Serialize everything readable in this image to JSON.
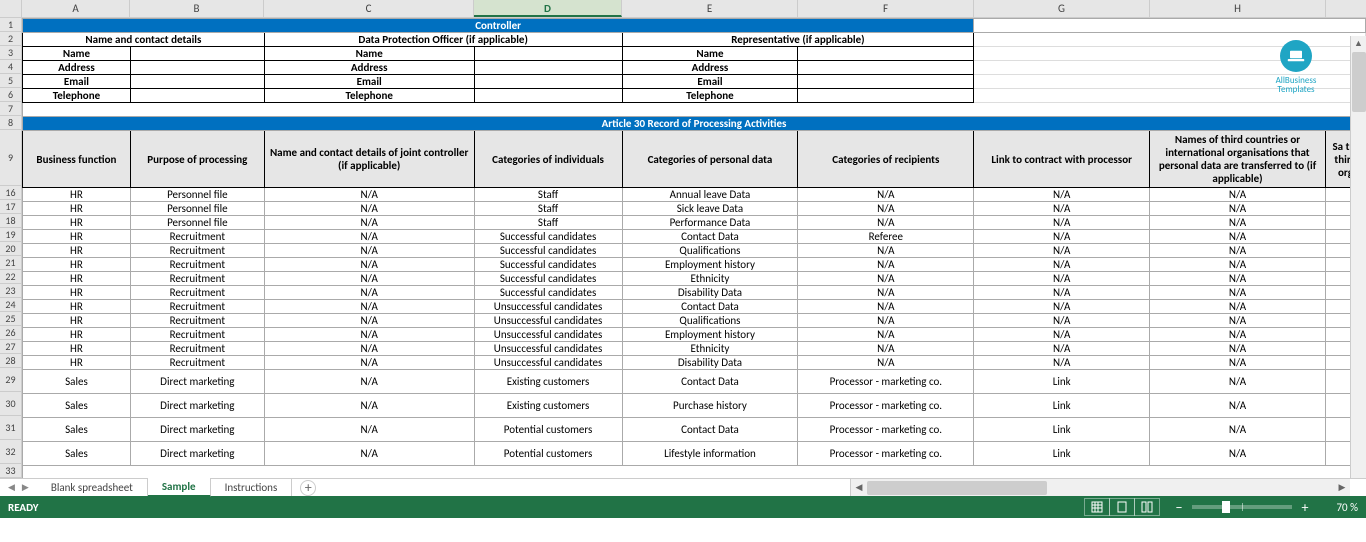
{
  "columns": [
    "A",
    "B",
    "C",
    "D",
    "E",
    "F",
    "G",
    "H"
  ],
  "selectedCol": "D",
  "rowNumbers": [
    "1",
    "2",
    "3",
    "4",
    "5",
    "6",
    "7",
    "8",
    "9",
    "16",
    "17",
    "18",
    "19",
    "20",
    "21",
    "22",
    "23",
    "24",
    "25",
    "26",
    "27",
    "28",
    "29",
    "30",
    "31",
    "32",
    "33"
  ],
  "section1": {
    "title": "Controller",
    "groups": [
      {
        "label": "Name and contact details"
      },
      {
        "label": "Data Protection Officer (if applicable)"
      },
      {
        "label": "Representative (if applicable)"
      }
    ],
    "fields": [
      "Name",
      "Address",
      "Email",
      "Telephone"
    ]
  },
  "section2": {
    "title": "Article 30 Record of Processing Activities",
    "headers": [
      "Business function",
      "Purpose of processing",
      "Name and contact details of joint controller (if applicable)",
      "Categories of individuals",
      "Categories of personal data",
      "Categories of recipients",
      "Link to contract with processor",
      "Names of third countries or international organisations that personal data are transferred to (if applicable)",
      "Sa tra third org"
    ],
    "rows": [
      [
        "HR",
        "Personnel file",
        "N/A",
        "Staff",
        "Annual leave Data",
        "N/A",
        "N/A",
        "N/A"
      ],
      [
        "HR",
        "Personnel file",
        "N/A",
        "Staff",
        "Sick leave Data",
        "N/A",
        "N/A",
        "N/A"
      ],
      [
        "HR",
        "Personnel file",
        "N/A",
        "Staff",
        "Performance Data",
        "N/A",
        "N/A",
        "N/A"
      ],
      [
        "HR",
        "Recruitment",
        "N/A",
        "Successful candidates",
        "Contact Data",
        "Referee",
        "N/A",
        "N/A"
      ],
      [
        "HR",
        "Recruitment",
        "N/A",
        "Successful candidates",
        "Qualifications",
        "N/A",
        "N/A",
        "N/A"
      ],
      [
        "HR",
        "Recruitment",
        "N/A",
        "Successful candidates",
        "Employment history",
        "N/A",
        "N/A",
        "N/A"
      ],
      [
        "HR",
        "Recruitment",
        "N/A",
        "Successful candidates",
        "Ethnicity",
        "N/A",
        "N/A",
        "N/A"
      ],
      [
        "HR",
        "Recruitment",
        "N/A",
        "Successful candidates",
        "Disability Data",
        "N/A",
        "N/A",
        "N/A"
      ],
      [
        "HR",
        "Recruitment",
        "N/A",
        "Unsuccessful candidates",
        "Contact Data",
        "N/A",
        "N/A",
        "N/A"
      ],
      [
        "HR",
        "Recruitment",
        "N/A",
        "Unsuccessful candidates",
        "Qualifications",
        "N/A",
        "N/A",
        "N/A"
      ],
      [
        "HR",
        "Recruitment",
        "N/A",
        "Unsuccessful candidates",
        "Employment history",
        "N/A",
        "N/A",
        "N/A"
      ],
      [
        "HR",
        "Recruitment",
        "N/A",
        "Unsuccessful candidates",
        "Ethnicity",
        "N/A",
        "N/A",
        "N/A"
      ],
      [
        "HR",
        "Recruitment",
        "N/A",
        "Unsuccessful candidates",
        "Disability Data",
        "N/A",
        "N/A",
        "N/A"
      ],
      [
        "Sales",
        "Direct marketing",
        "N/A",
        "Existing customers",
        "Contact Data",
        "Processor - marketing co.",
        "Link",
        "N/A"
      ],
      [
        "Sales",
        "Direct marketing",
        "N/A",
        "Existing customers",
        "Purchase history",
        "Processor - marketing co.",
        "Link",
        "N/A"
      ],
      [
        "Sales",
        "Direct marketing",
        "N/A",
        "Potential customers",
        "Contact Data",
        "Processor - marketing co.",
        "Link",
        "N/A"
      ],
      [
        "Sales",
        "Direct marketing",
        "N/A",
        "Potential customers",
        "Lifestyle information",
        "Processor - marketing co.",
        "Link",
        "N/A"
      ]
    ]
  },
  "logo": {
    "line1": "AllBusiness",
    "line2": "Templates"
  },
  "tabs": [
    "Blank spreadsheet",
    "Sample",
    "Instructions"
  ],
  "activeTab": 1,
  "status": "READY",
  "zoom": "70 %"
}
